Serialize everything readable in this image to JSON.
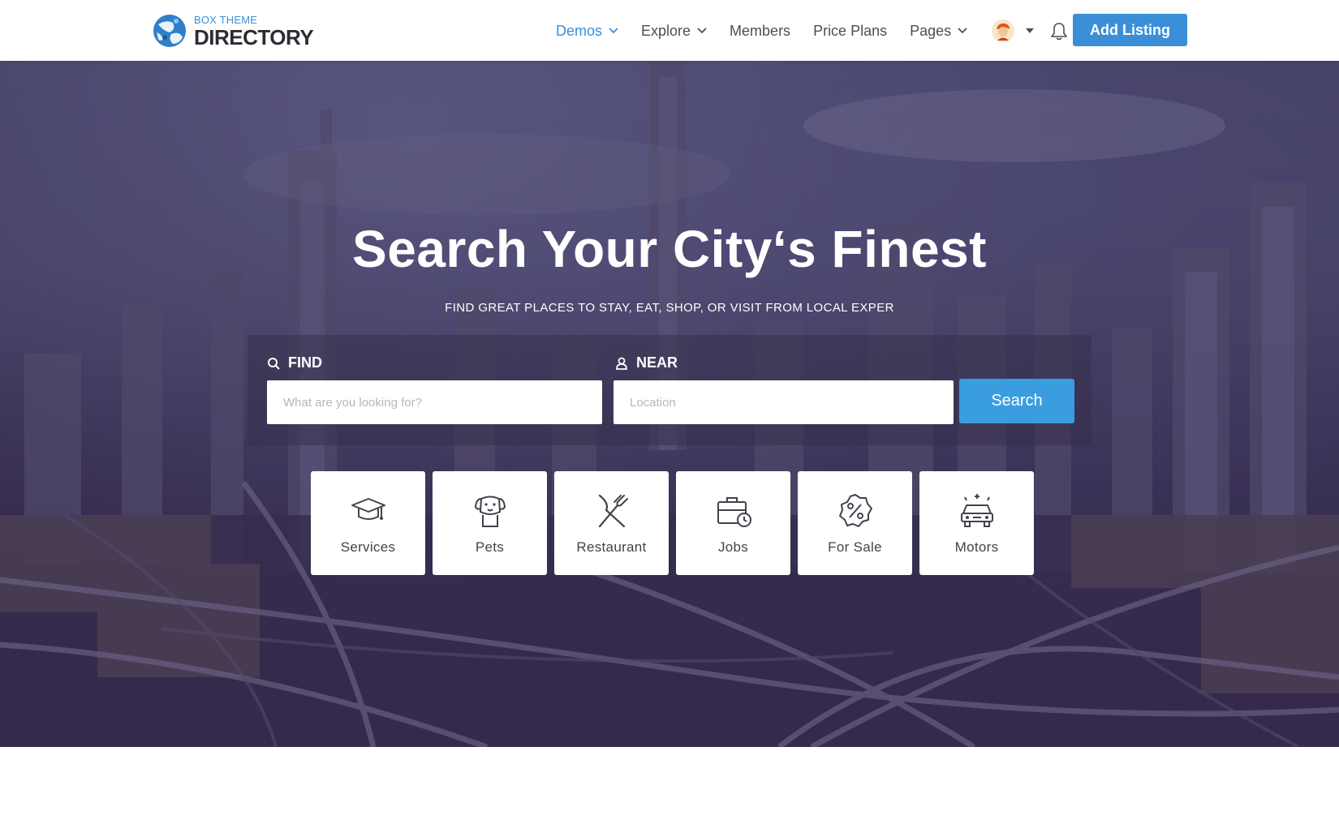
{
  "brand": {
    "small": "BOX THEME",
    "big": "DIRECTORY"
  },
  "nav": {
    "items": [
      {
        "label": "Demos",
        "has_dropdown": true,
        "active": true
      },
      {
        "label": "Explore",
        "has_dropdown": true,
        "active": false
      },
      {
        "label": "Members",
        "has_dropdown": false,
        "active": false
      },
      {
        "label": "Price Plans",
        "has_dropdown": false,
        "active": false
      },
      {
        "label": "Pages",
        "has_dropdown": true,
        "active": false
      }
    ],
    "add_listing": "Add Listing"
  },
  "hero": {
    "title": "Search Your City‘s Finest",
    "subtitle": "FIND GREAT PLACES TO STAY, EAT, SHOP, OR VISIT FROM LOCAL EXPER"
  },
  "search": {
    "find_label": "FIND",
    "find_placeholder": "What are you looking for?",
    "near_label": "NEAR",
    "near_placeholder": "Location",
    "button": "Search"
  },
  "categories": [
    {
      "label": "Services",
      "icon": "graduation-cap-icon"
    },
    {
      "label": "Pets",
      "icon": "dog-icon"
    },
    {
      "label": "Restaurant",
      "icon": "fork-knife-icon"
    },
    {
      "label": "Jobs",
      "icon": "briefcase-clock-icon"
    },
    {
      "label": "For Sale",
      "icon": "percent-badge-icon"
    },
    {
      "label": "Motors",
      "icon": "car-icon"
    }
  ],
  "colors": {
    "accent": "#3a8fd8",
    "search_button": "#3a9de0",
    "text": "#4a4f57"
  }
}
